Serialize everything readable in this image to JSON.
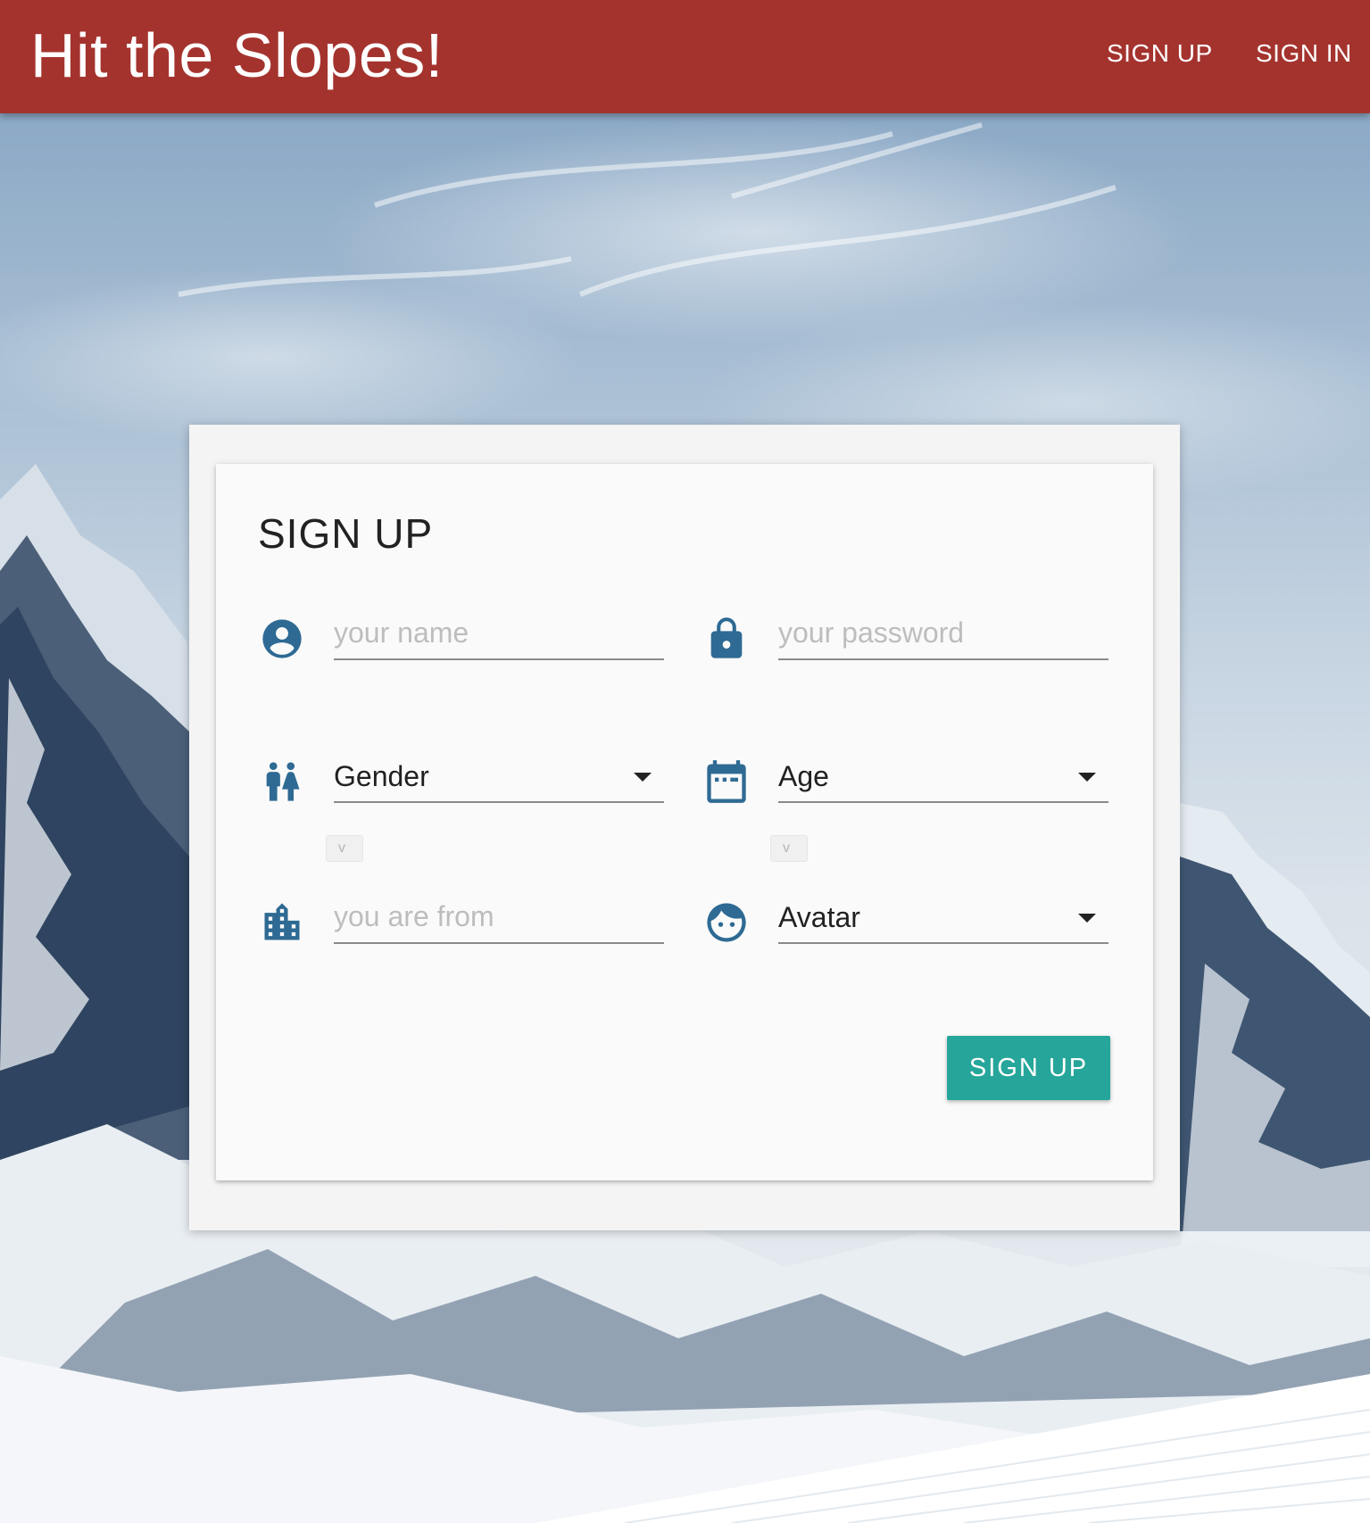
{
  "app": {
    "title": "Hit the Slopes!",
    "nav": {
      "signup": "SIGN UP",
      "signin": "SIGN IN"
    }
  },
  "form": {
    "title": "SIGN UP",
    "name": {
      "placeholder": "your name",
      "value": "",
      "icon": "account-circle-icon"
    },
    "password": {
      "placeholder": "your password",
      "value": "",
      "icon": "lock-icon"
    },
    "gender": {
      "selected": "Gender",
      "icon": "wc-icon"
    },
    "age": {
      "selected": "Age",
      "icon": "calendar-icon"
    },
    "location": {
      "placeholder": "you are from",
      "value": "",
      "icon": "city-icon"
    },
    "avatar": {
      "selected": "Avatar",
      "icon": "face-icon"
    },
    "gender_native_select_arrow": "v",
    "age_native_select_arrow": "v",
    "submit_label": "SIGN UP"
  },
  "colors": {
    "appbar": "#a4332e",
    "icon": "#2e6a93",
    "button": "#26a69a"
  }
}
